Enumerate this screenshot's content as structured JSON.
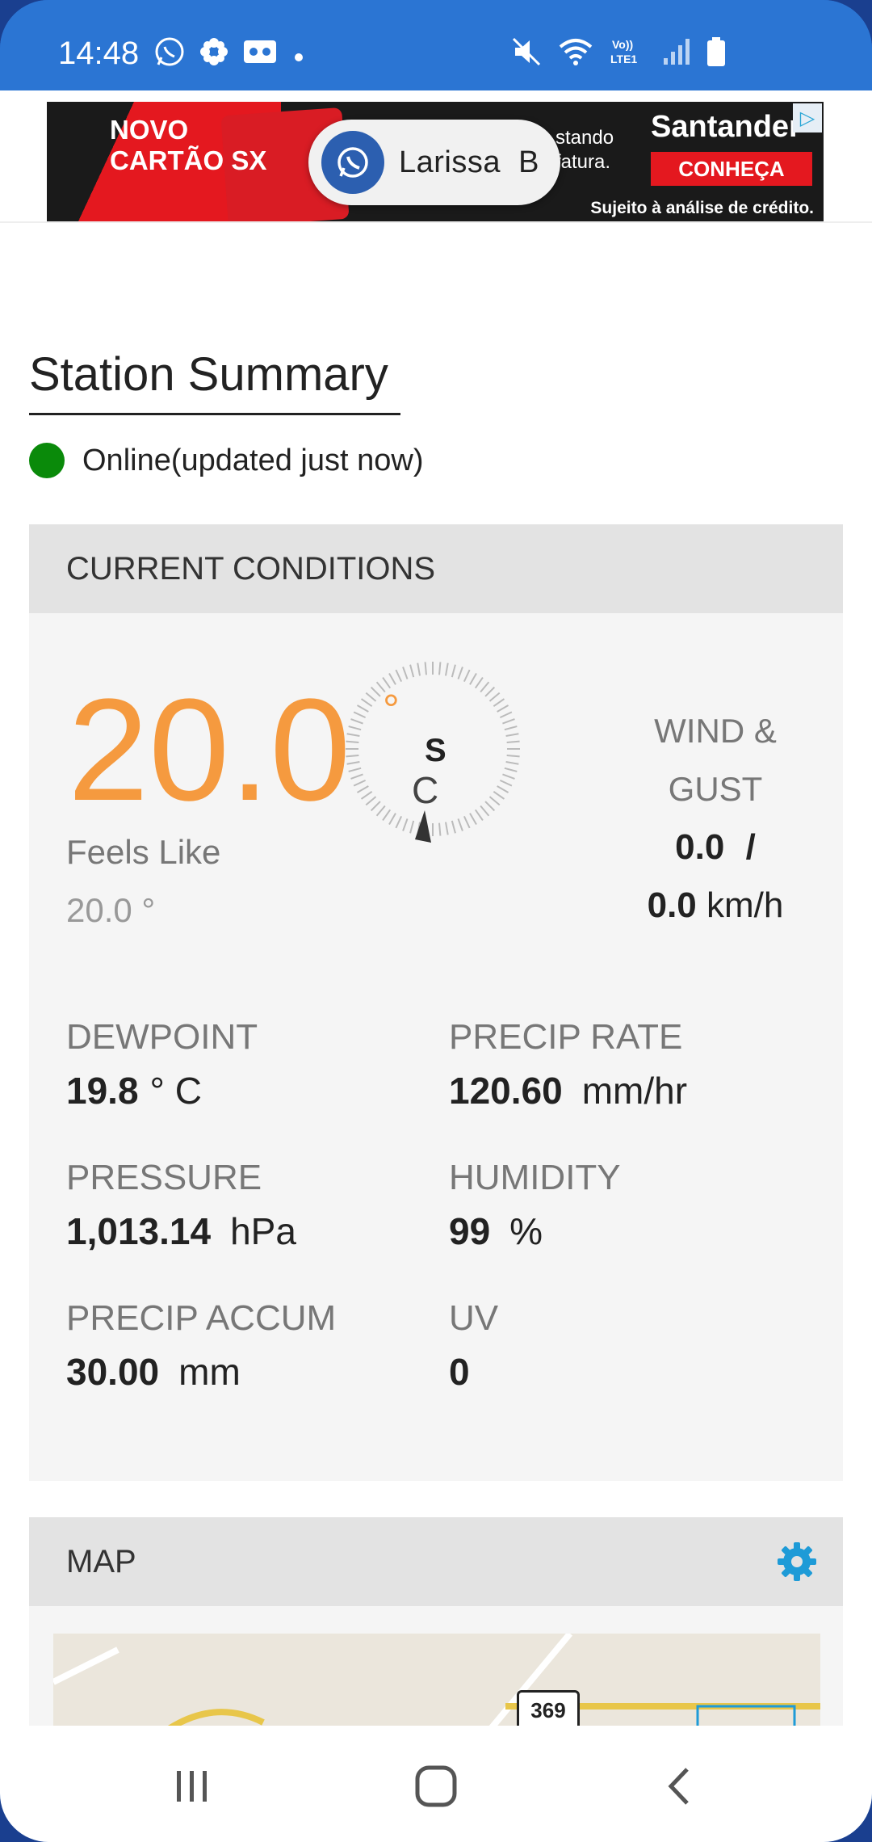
{
  "status_bar": {
    "time": "14:48",
    "left_icons": [
      "whatsapp-icon",
      "flower-icon",
      "voicemail-icon",
      "dot-icon"
    ],
    "right_icons": [
      "mute-icon",
      "wifi-icon",
      "lte-icon",
      "signal-icon",
      "battery-icon"
    ],
    "lte_label": "Vo))\nLTE1"
  },
  "ad": {
    "title_line1": "NOVO",
    "title_line2": "CARTÃO SX",
    "middle_text": "stando\nfatura.",
    "brand": "Santander",
    "cta": "CONHEÇA",
    "fine_print": "Sujeito à análise de crédito."
  },
  "chat_head": {
    "name": "Larissa  B"
  },
  "page": {
    "title": "Station Summary",
    "status_text": "Online(updated just now)",
    "status_color": "#0a8a0a"
  },
  "current_conditions": {
    "header": "CURRENT CONDITIONS",
    "temperature": "20.0",
    "degree_symbol": "°",
    "compass_direction": "S",
    "unit": "C",
    "feels_like_label": "Feels Like",
    "feels_like_value": "20.0 °",
    "wind_label_line1": "WIND &",
    "wind_label_line2": "GUST",
    "wind_value": "0.0",
    "wind_sep": "/",
    "gust_value": "0.0",
    "wind_unit": "km/h",
    "metrics": {
      "dewpoint": {
        "label": "DEWPOINT",
        "value": "19.8",
        "unit": "° C"
      },
      "precip_rate": {
        "label": "PRECIP RATE",
        "value": "120.60",
        "unit": "mm/hr"
      },
      "pressure": {
        "label": "PRESSURE",
        "value": "1,013.14",
        "unit": "hPa"
      },
      "humidity": {
        "label": "HUMIDITY",
        "value": "99",
        "unit": "%"
      },
      "precip_accum": {
        "label": "PRECIP ACCUM",
        "value": "30.00",
        "unit": "mm"
      },
      "uv": {
        "label": "UV",
        "value": "0",
        "unit": ""
      }
    }
  },
  "map": {
    "header": "MAP",
    "road_number": "369"
  },
  "colors": {
    "accent_orange": "#f59a3f",
    "gear_blue": "#1e9bd7",
    "status_bar": "#2b75d3"
  }
}
